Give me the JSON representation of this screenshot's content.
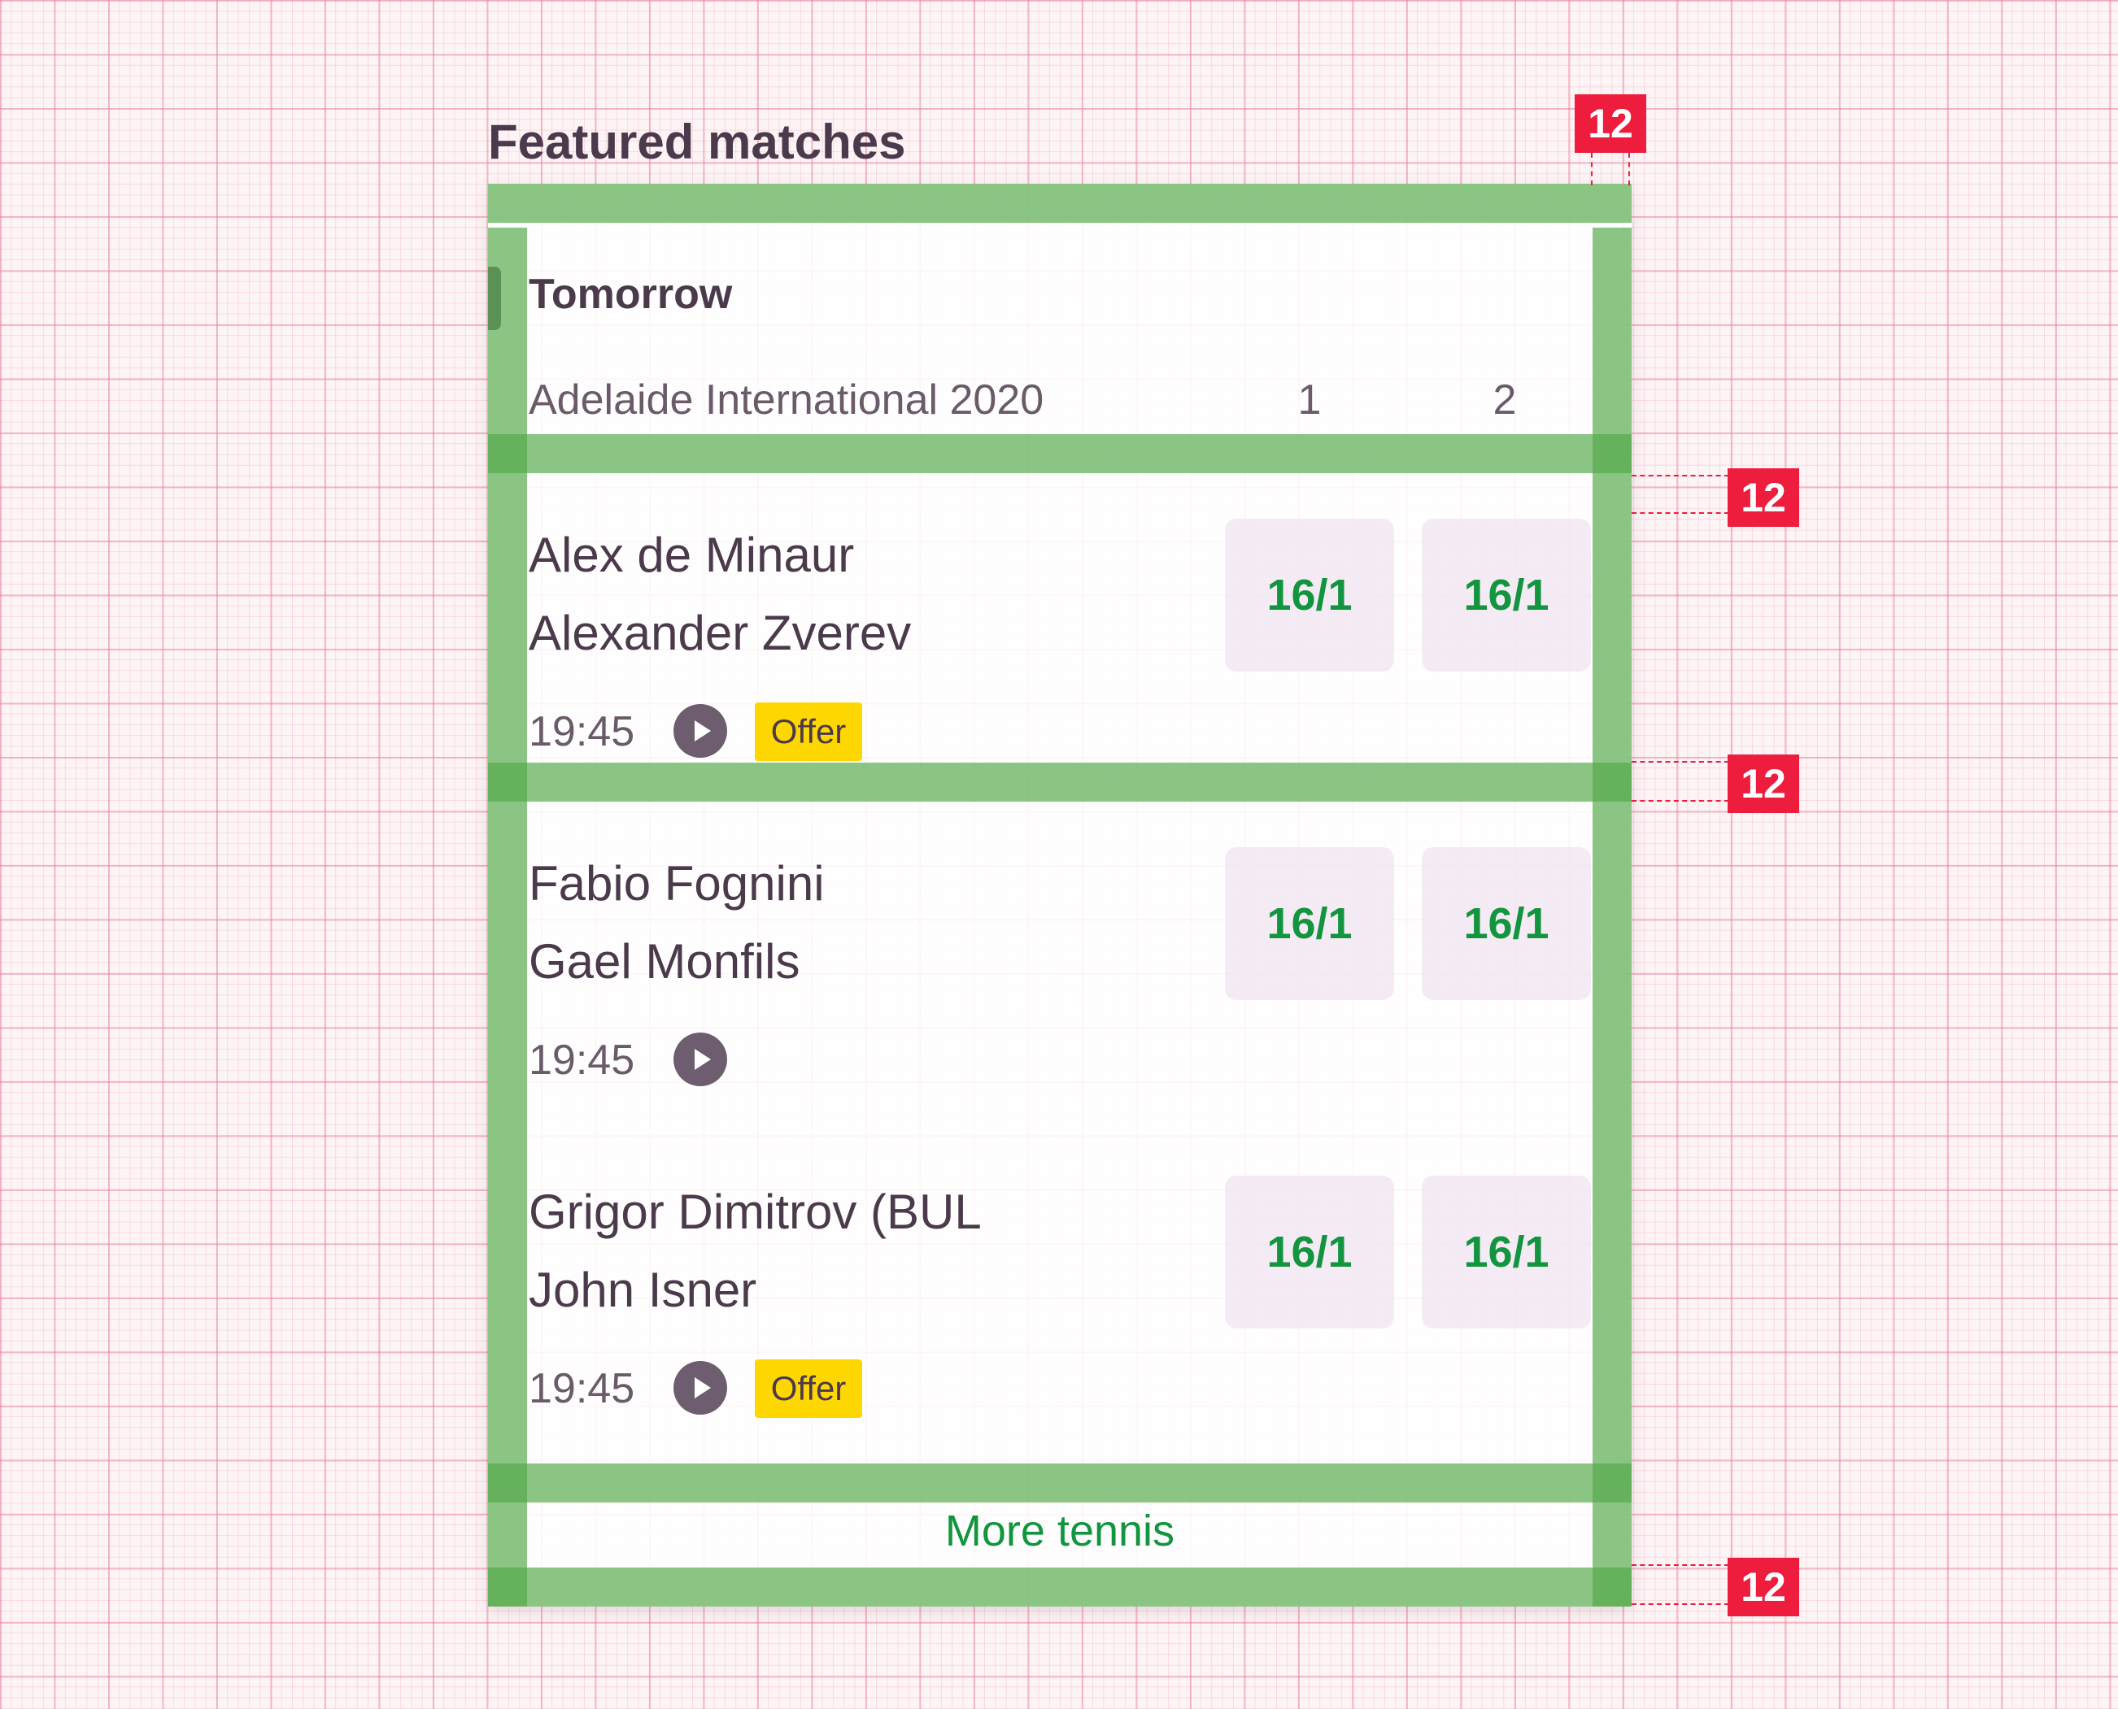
{
  "section_title": "Featured matches",
  "day_label": "Tomorrow",
  "league": {
    "name": "Adelaide International 2020",
    "col1": "1",
    "col2": "2"
  },
  "matches": [
    {
      "player1": "Alex de Minaur",
      "player2": "Alexander Zverev",
      "time": "19:45",
      "odds1": "16/1",
      "odds2": "16/1",
      "offer": "Offer"
    },
    {
      "player1": "Fabio Fognini",
      "player2": "Gael Monfils",
      "time": "19:45",
      "odds1": "16/1",
      "odds2": "16/1"
    },
    {
      "player1": "Grigor Dimitrov (BUL",
      "player2": "John Isner",
      "time": "19:45",
      "odds1": "16/1",
      "odds2": "16/1",
      "offer": "Offer"
    }
  ],
  "more_link": "More tennis",
  "spacing_labels": [
    "12",
    "12",
    "12",
    "12"
  ],
  "colors": {
    "odds_text": "#12953e",
    "offer_badge": "#ffd700",
    "spacing_overlay": "#54aa4a",
    "measure_label": "#ee1c3d",
    "text_primary": "#4b3a4b"
  }
}
